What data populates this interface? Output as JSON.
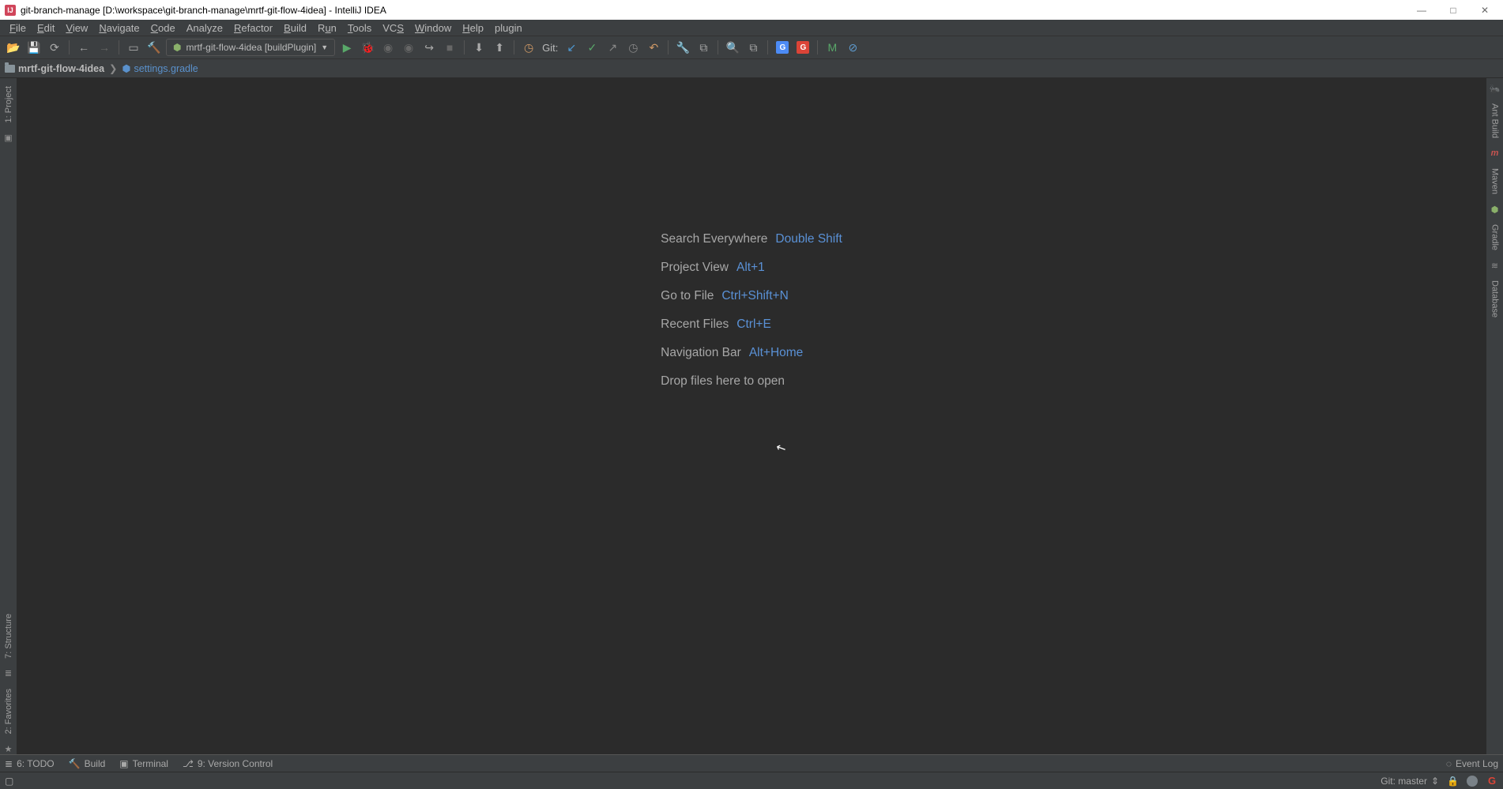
{
  "titlebar": {
    "text": "git-branch-manage [D:\\workspace\\git-branch-manage\\mrtf-git-flow-4idea] - IntelliJ IDEA"
  },
  "menubar": {
    "file": "File",
    "edit": "Edit",
    "view": "View",
    "navigate": "Navigate",
    "code": "Code",
    "analyze": "Analyze",
    "refactor": "Refactor",
    "build": "Build",
    "run": "Run",
    "tools": "Tools",
    "vcs": "VCS",
    "window": "Window",
    "help": "Help",
    "plugin": "plugin"
  },
  "toolbar": {
    "run_config": "mrtf-git-flow-4idea [buildPlugin]",
    "git_label": "Git:"
  },
  "breadcrumbs": {
    "project": "mrtf-git-flow-4idea",
    "file": "settings.gradle"
  },
  "left_gutter": {
    "project": "1: Project",
    "structure": "7: Structure",
    "favorites": "2: Favorites"
  },
  "right_gutter": {
    "antbuild": "Ant Build",
    "maven": "Maven",
    "gradle": "Gradle",
    "database": "Database"
  },
  "welcome": {
    "search_label": "Search Everywhere",
    "search_key": "Double Shift",
    "project_label": "Project View",
    "project_key": "Alt+1",
    "gotofile_label": "Go to File",
    "gotofile_key": "Ctrl+Shift+N",
    "recent_label": "Recent Files",
    "recent_key": "Ctrl+E",
    "navbar_label": "Navigation Bar",
    "navbar_key": "Alt+Home",
    "drop_label": "Drop files here to open"
  },
  "bottom_tools": {
    "todo": "6: TODO",
    "build": "Build",
    "terminal": "Terminal",
    "vcs": "9: Version Control",
    "eventlog": "Event Log"
  },
  "status": {
    "git": "Git: master"
  }
}
